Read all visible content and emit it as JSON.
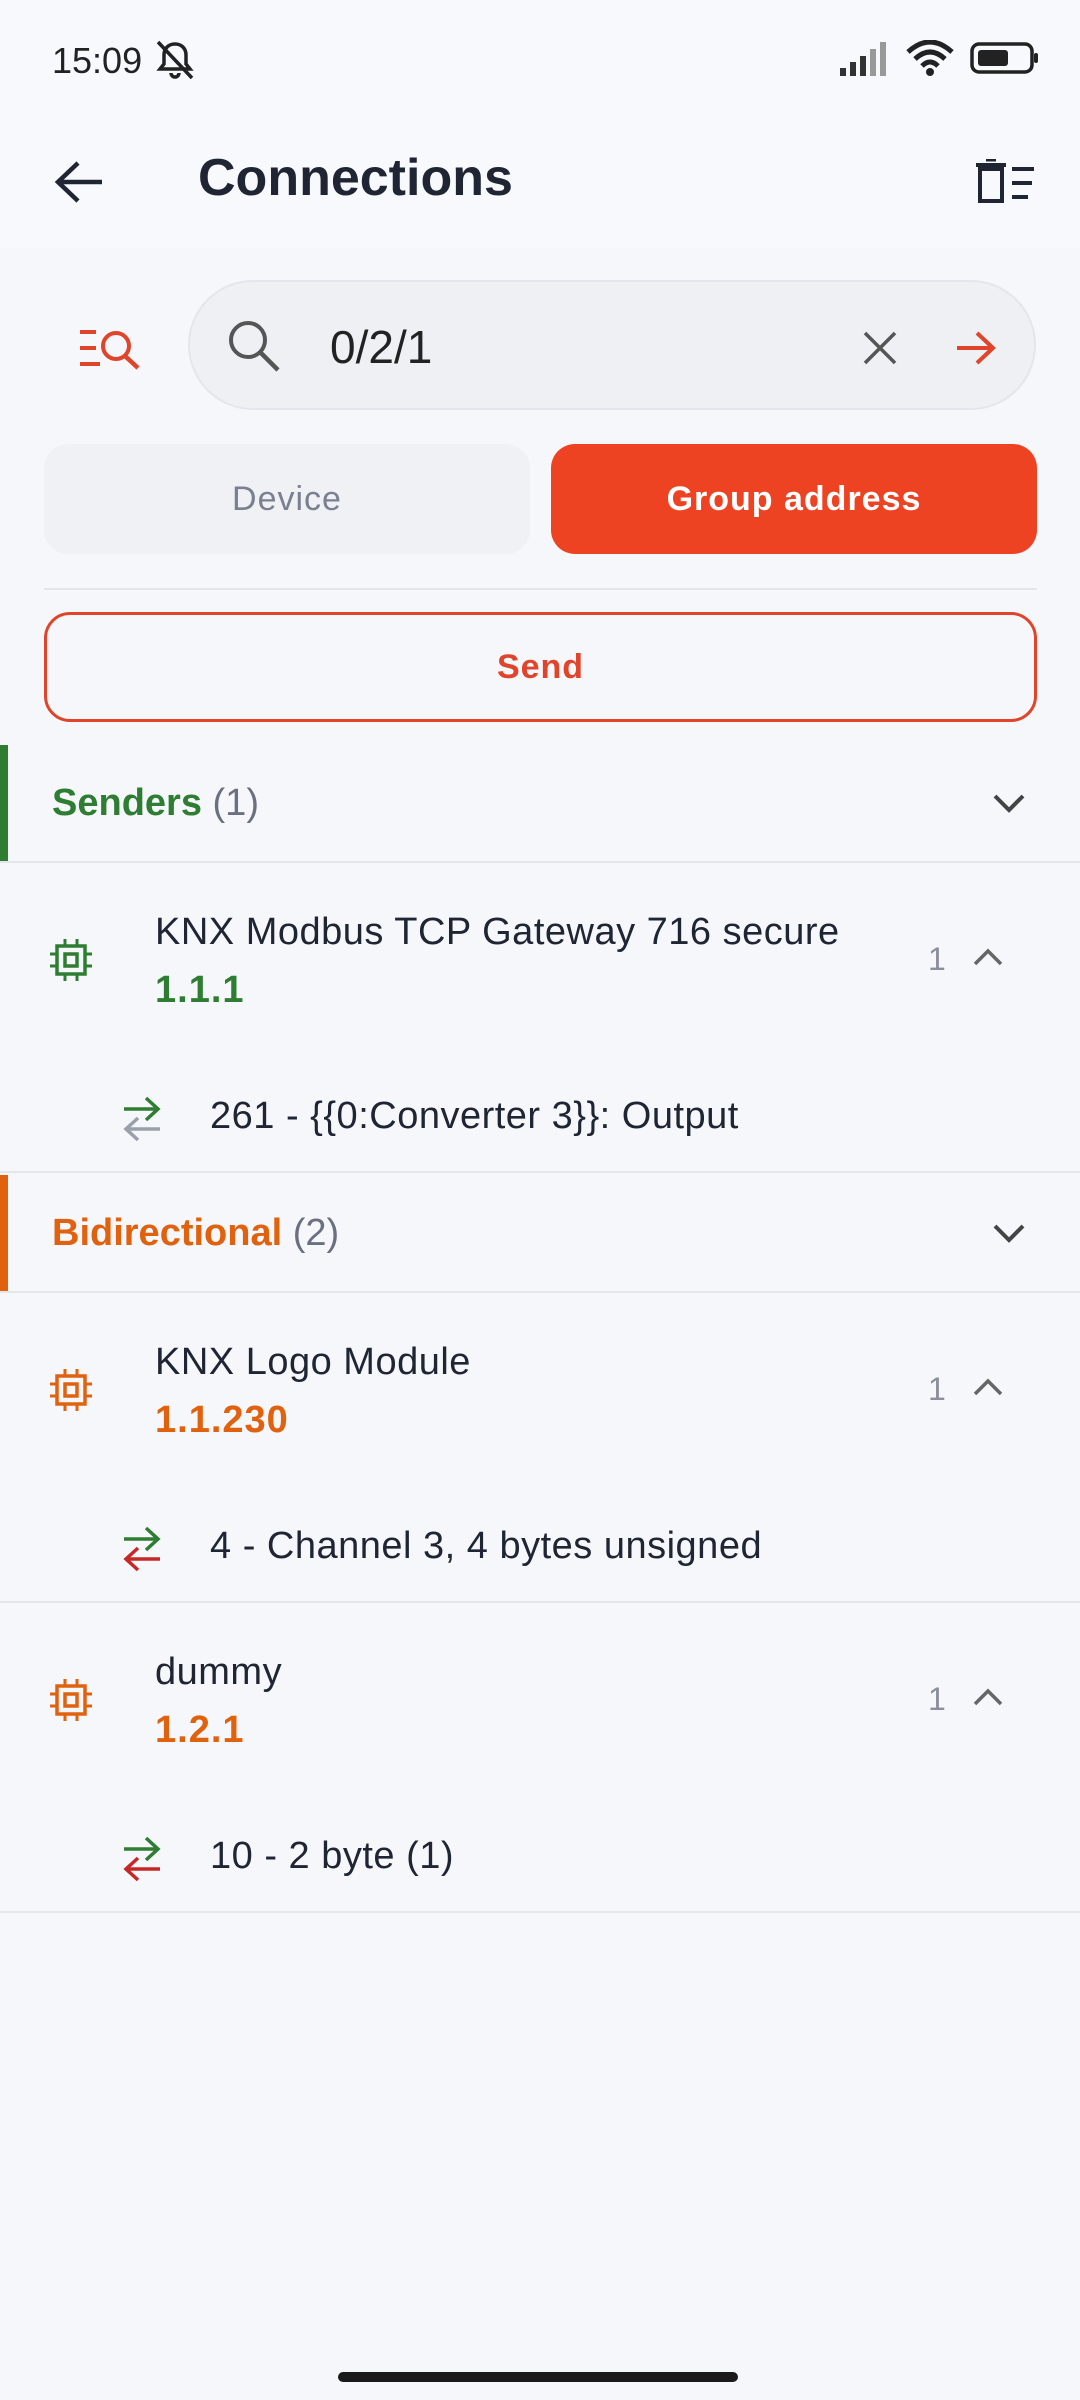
{
  "status": {
    "time": "15:09"
  },
  "header": {
    "title": "Connections"
  },
  "search": {
    "value": "0/2/1",
    "placeholder": ""
  },
  "segments": {
    "device_label": "Device",
    "group_label": "Group address",
    "selected": "Group address"
  },
  "send_label": "Send",
  "colors": {
    "accent": "#ee4323",
    "senders": "#2e7d32",
    "bidirectional": "#e0620f"
  },
  "sections": [
    {
      "title": "Senders",
      "count": "(1)",
      "devices": [
        {
          "name": "KNX Modbus TCP Gateway 716 secure",
          "address": "1.1.1",
          "count": "1",
          "objects": [
            "261 - {{0:Converter 3}}: Output"
          ]
        }
      ]
    },
    {
      "title": "Bidirectional",
      "count": "(2)",
      "devices": [
        {
          "name": "KNX Logo Module",
          "address": "1.1.230",
          "count": "1",
          "objects": [
            "4 - Channel 3, 4 bytes unsigned"
          ]
        },
        {
          "name": "dummy",
          "address": "1.2.1",
          "count": "1",
          "objects": [
            "10 - 2 byte (1)"
          ]
        }
      ]
    }
  ]
}
